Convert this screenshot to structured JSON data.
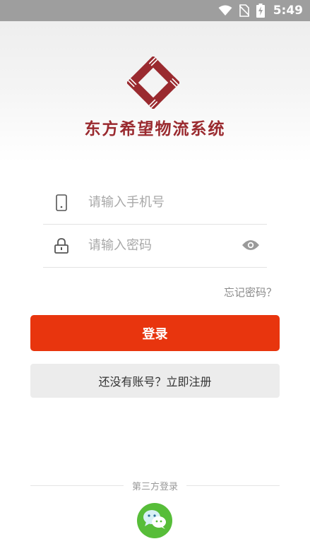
{
  "status_bar": {
    "time": "5:49",
    "icons": [
      "wifi-icon",
      "no-sim-icon",
      "battery-charging-icon"
    ],
    "background": "#9e9e9e"
  },
  "app": {
    "title": "东方希望物流系统",
    "brand_color": "#9a2a2f"
  },
  "form": {
    "phone_placeholder": "请输入手机号",
    "password_placeholder": "请输入密码",
    "phone_icon": "phone-icon",
    "lock_icon": "lock-icon",
    "eye_icon": "eye-icon",
    "forgot_label": "忘记密码？"
  },
  "actions": {
    "login_label": "登录",
    "login_color": "#e8350e",
    "register_label": "还没有账号？立即注册"
  },
  "third_party": {
    "label": "第三方登录",
    "wechat_icon": "wechat-icon",
    "wechat_color": "#57bd39"
  }
}
